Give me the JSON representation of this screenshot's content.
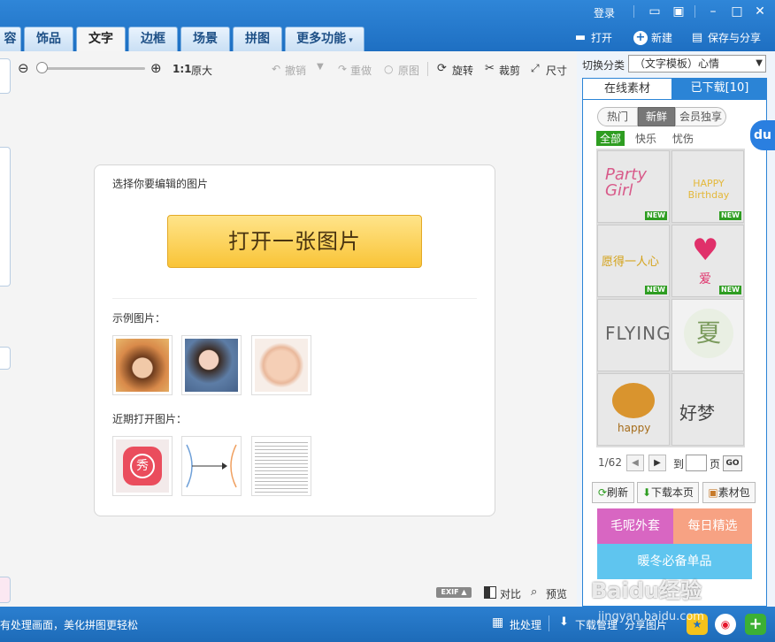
{
  "window": {
    "login": "登录"
  },
  "tabs": [
    "容",
    "饰品",
    "文字",
    "边框",
    "场景",
    "拼图",
    "更多功能"
  ],
  "actions": {
    "open": "打开",
    "new": "新建",
    "save": "保存与分享"
  },
  "toolbar": {
    "ratio": "1:1",
    "original_size": "原大",
    "undo": "撤销",
    "redo": "重做",
    "origin": "原图",
    "rotate": "旋转",
    "crop": "裁剪",
    "size": "尺寸"
  },
  "card": {
    "select_label": "选择你要编辑的图片",
    "open_button": "打开一张图片",
    "sample_label": "示例图片：",
    "recent_label": "近期打开图片："
  },
  "canvas_bottom": {
    "exif": "EXIF",
    "compare": "对比",
    "preview": "预览"
  },
  "right": {
    "category_label": "切换分类",
    "category_value": "（文字模板）心情",
    "tab_online": "在线素材",
    "tab_downloaded": "已下载[10]",
    "filters": [
      "热门",
      "新鲜",
      "会员独享"
    ],
    "subfilters": [
      "全部",
      "快乐",
      "忧伤"
    ],
    "new_badge": "NEW",
    "stickers": [
      "Party Girl",
      "HAPPY Birthday",
      "愿得一人心",
      "爱",
      "FLYING",
      "夏",
      "happy",
      "好梦"
    ],
    "page_current": "1/62",
    "page_to": "到",
    "page_unit": "页",
    "go": "GO",
    "refresh": "刷新",
    "download_page": "下载本页",
    "material_pack": "素材包",
    "ads": [
      "毛呢外套",
      "每日精选",
      "暖冬必备单品"
    ]
  },
  "status": {
    "left_text": "有处理画面，美化拼图更轻松",
    "batch": "批处理",
    "download_manage": "下载管理",
    "share_image": "分享图片"
  },
  "watermark": {
    "brand": "Baidu经验",
    "url": "jingyan.baidu.com"
  }
}
